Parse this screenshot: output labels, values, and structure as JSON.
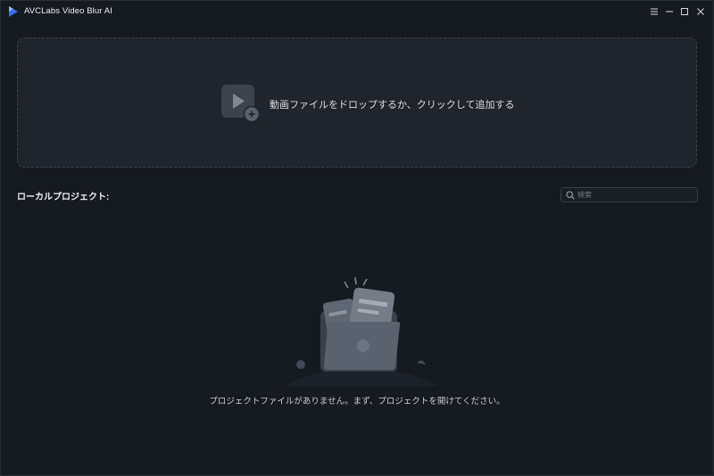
{
  "window": {
    "title": "AVCLabs Video Blur AI",
    "controls": [
      "menu-icon",
      "minimize-icon",
      "maximize-icon",
      "close-icon"
    ]
  },
  "drop_zone": {
    "text": "動画ファイルをドロップするか、クリックして追加する",
    "icon": "add-video-icon"
  },
  "projects": {
    "title": "ローカルプロジェクト:",
    "search_placeholder": "検索",
    "empty_message": "プロジェクトファイルがありません。まず、プロジェクトを開けてください。",
    "empty_icon": "empty-folder-illustration"
  },
  "colors": {
    "background": "#161a21",
    "panel": "#20242c",
    "accent": "#3d7bff"
  }
}
